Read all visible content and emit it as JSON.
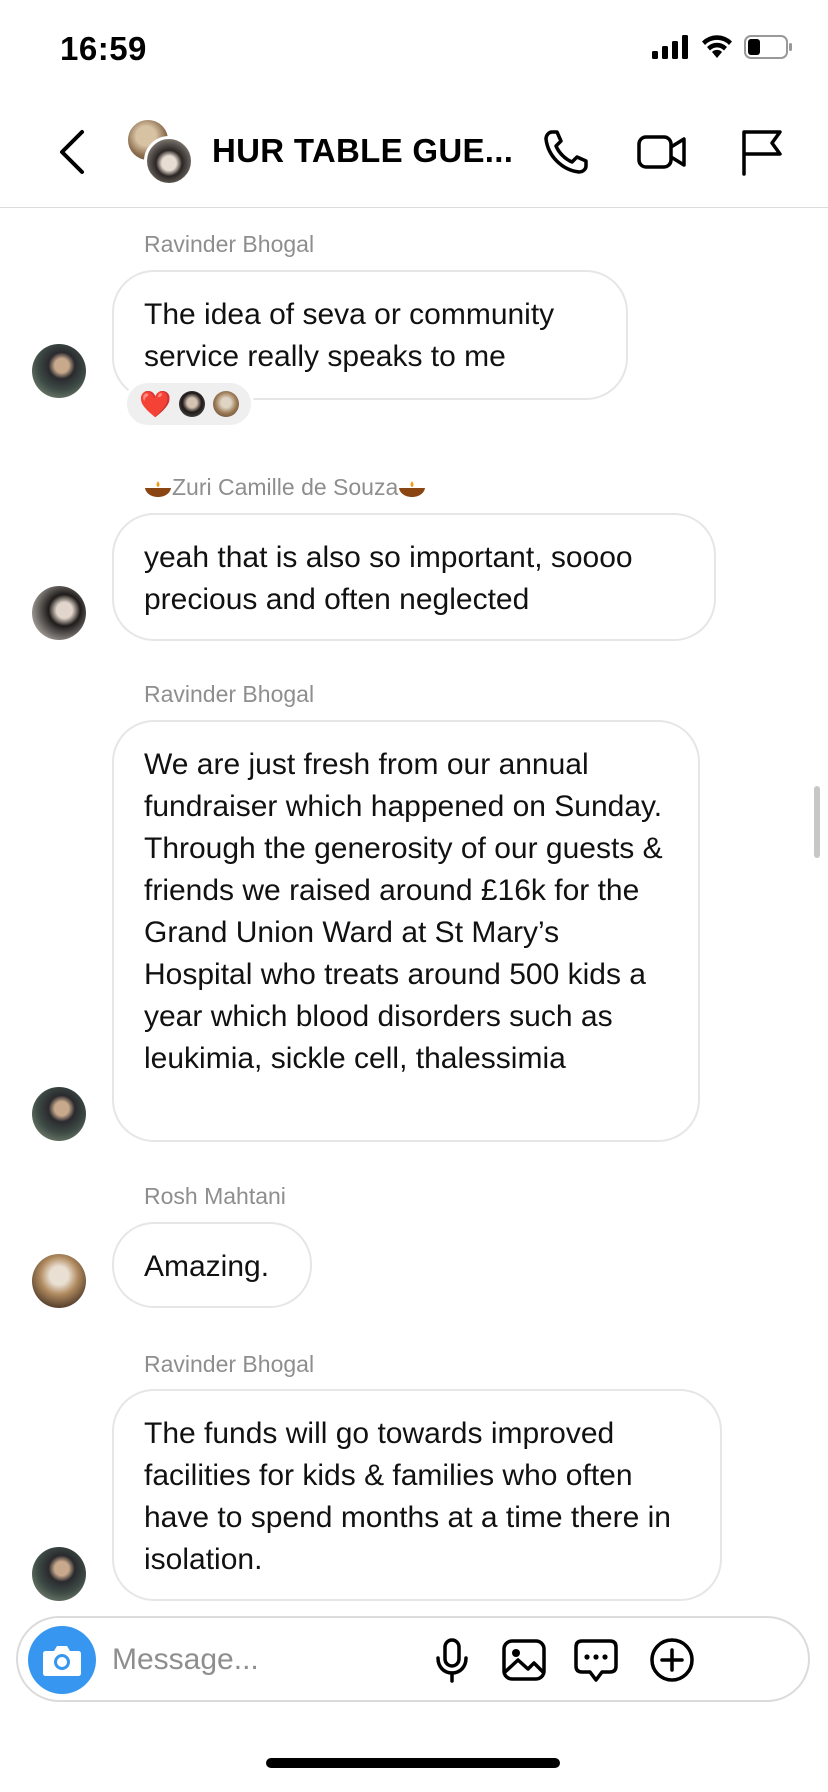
{
  "status": {
    "time": "16:59"
  },
  "header": {
    "title": "HUR TABLE GUE...",
    "icons": [
      "back-icon",
      "phone-icon",
      "video-camera-icon",
      "flag-icon"
    ]
  },
  "messages": [
    {
      "sender": "Ravinder Bhogal",
      "text": "The idea of seva or community service really speaks to me",
      "reactions": [
        "❤️"
      ]
    },
    {
      "sender": "Zuri Camille de Souza",
      "text": "yeah that is also so important, soooo precious and often neglected"
    },
    {
      "sender": "Ravinder Bhogal",
      "text": "We are just fresh from our annual fundraiser which happened on Sunday. Through the generosity of our guests & friends we raised around £16k for the Grand Union Ward at St Mary’s Hospital who treats around 500 kids a year which blood disorders such as leukimia, sickle cell, thalessimia"
    },
    {
      "sender": "Rosh Mahtani",
      "text": "Amazing."
    },
    {
      "sender": "Ravinder Bhogal",
      "text": "The funds will go towards improved facilities for kids & families who often have to spend months at a time there in isolation."
    }
  ],
  "composer": {
    "placeholder": "Message...",
    "icons": [
      "camera-icon",
      "microphone-icon",
      "gallery-icon",
      "sticker-icon",
      "plus-icon"
    ]
  },
  "colors": {
    "accent": "#3797f0",
    "bubble_border": "#e6e6e6",
    "sender_text": "#8e8e8e",
    "reaction_heart": "#e0245e"
  }
}
